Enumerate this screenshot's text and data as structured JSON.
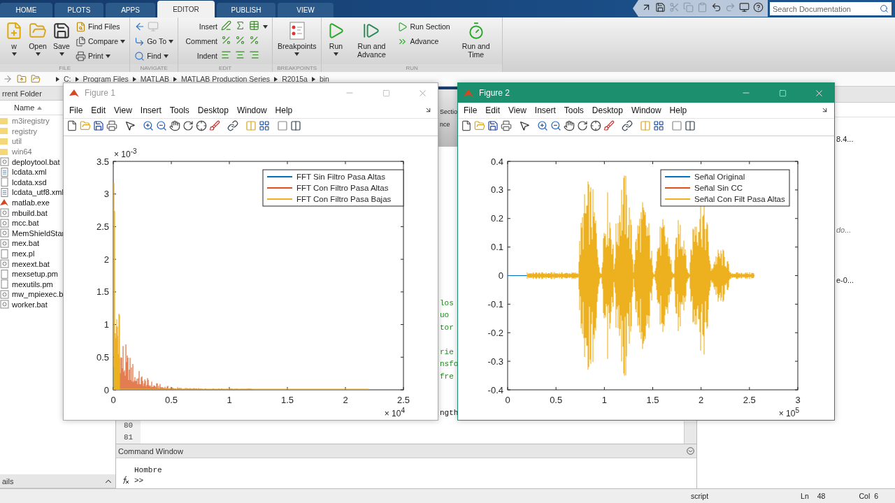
{
  "tabs": [
    {
      "label": "HOME",
      "selected": false
    },
    {
      "label": "PLOTS",
      "selected": false
    },
    {
      "label": "APPS",
      "selected": false
    },
    {
      "label": "EDITOR",
      "selected": true
    },
    {
      "label": "PUBLISH",
      "selected": false
    },
    {
      "label": "VIEW",
      "selected": false
    }
  ],
  "search": {
    "placeholder": "Search Documentation"
  },
  "toolstrip": [
    {
      "title": "FILE",
      "items": [
        {
          "label": "w",
          "kind": "large",
          "caret": true
        },
        {
          "label": "Open",
          "kind": "large",
          "caret": true
        },
        {
          "label": "Save",
          "kind": "large",
          "caret": true
        },
        {
          "label": "Find Files",
          "kind": "small",
          "caret": false
        },
        {
          "label": "Compare",
          "kind": "small",
          "caret": true
        },
        {
          "label": "Print",
          "kind": "small",
          "caret": true
        }
      ]
    },
    {
      "title": "NAVIGATE",
      "items": [
        {
          "kind": "arrows"
        },
        {
          "label": "Go To",
          "kind": "small",
          "caret": true
        },
        {
          "label": "Find",
          "kind": "small",
          "caret": true
        }
      ]
    },
    {
      "title": "EDIT",
      "items": [
        {
          "label": "Insert",
          "kind": "row",
          "caret": true
        },
        {
          "label": "Comment",
          "kind": "row",
          "caret": false
        },
        {
          "label": "Indent",
          "kind": "row",
          "caret": false
        }
      ]
    },
    {
      "title": "BREAKPOINTS",
      "items": [
        {
          "label": "Breakpoints",
          "kind": "large",
          "caret": true
        }
      ]
    },
    {
      "title": "RUN",
      "items": [
        {
          "label": "Run",
          "kind": "large",
          "caret": true
        },
        {
          "label": "Run and Advance",
          "kind": "large",
          "caret": false
        },
        {
          "label": "Run Section",
          "kind": "small",
          "caret": false
        },
        {
          "label": "Advance",
          "kind": "small",
          "caret": false
        },
        {
          "label": "Run and Time",
          "kind": "large",
          "caret": false
        }
      ]
    }
  ],
  "address": [
    "C:",
    "Program Files",
    "MATLAB",
    "MATLAB Production Series",
    "R2015a",
    "bin"
  ],
  "folder_panel": {
    "title": "rrent Folder",
    "column": "Name",
    "footer": "ails",
    "items": [
      {
        "name": "m3iregistry",
        "kind": "folder"
      },
      {
        "name": "registry",
        "kind": "folder"
      },
      {
        "name": "util",
        "kind": "folder"
      },
      {
        "name": "win64",
        "kind": "folder"
      },
      {
        "name": "deploytool.bat",
        "kind": "bat"
      },
      {
        "name": "lcdata.xml",
        "kind": "xml"
      },
      {
        "name": "lcdata.xsd",
        "kind": "blank"
      },
      {
        "name": "lcdata_utf8.xml",
        "kind": "xml"
      },
      {
        "name": "matlab.exe",
        "kind": "matlab"
      },
      {
        "name": "mbuild.bat",
        "kind": "bat"
      },
      {
        "name": "mcc.bat",
        "kind": "bat"
      },
      {
        "name": "MemShieldStar",
        "kind": "bat"
      },
      {
        "name": "mex.bat",
        "kind": "bat"
      },
      {
        "name": "mex.pl",
        "kind": "blank"
      },
      {
        "name": "mexext.bat",
        "kind": "bat"
      },
      {
        "name": "mexsetup.pm",
        "kind": "blank"
      },
      {
        "name": "mexutils.pm",
        "kind": "blank"
      },
      {
        "name": "mw_mpiexec.b",
        "kind": "bat"
      },
      {
        "name": "worker.bat",
        "kind": "bat"
      }
    ]
  },
  "editor": {
    "toolstrip": [
      "Sectio",
      "nce"
    ],
    "code": [
      {
        "text": "los",
        "kind": "comment"
      },
      {
        "text": "uo",
        "kind": "comment"
      },
      {
        "text": "tor",
        "kind": "comment"
      },
      {
        "text": "rie",
        "kind": "comment"
      },
      {
        "text": "nsfo",
        "kind": "comment"
      },
      {
        "text": "fre",
        "kind": "comment"
      },
      {
        "text": "ngth",
        "kind": "code"
      }
    ],
    "line_numbers": [
      "80",
      "81"
    ]
  },
  "command_window": {
    "title": "Command Window",
    "lines": [
      "Hombre"
    ],
    "prompt": ">>"
  },
  "workspace": [
    {
      "text": "8.4...",
      "kind": "value"
    },
    {
      "text": "do...",
      "kind": "note"
    },
    {
      "text": "e-0...",
      "kind": "value"
    }
  ],
  "status_bar": {
    "type": "script",
    "ln_label": "Ln",
    "ln": "48",
    "col_label": "Col",
    "col": "6"
  },
  "figures": [
    {
      "title": "Figure 1",
      "active": false,
      "kind": "spectrum",
      "menu": [
        "File",
        "Edit",
        "View",
        "Insert",
        "Tools",
        "Desktop",
        "Window",
        "Help"
      ],
      "yticks": [
        "3.5",
        "3",
        "2.5",
        "2",
        "1.5",
        "1",
        "0.5",
        "0"
      ],
      "xticks": [
        "0",
        "0.5",
        "1",
        "1.5",
        "2",
        "2.5"
      ],
      "y_multiplier": "× 10$^{-3}$",
      "x_multiplier": "× 10$^{4}$",
      "legend": [
        {
          "label": "FFT Sin Filtro Pasa Altas",
          "color": "#0072bd"
        },
        {
          "label": "FFT Con Filtro Pasa Altas",
          "color": "#d95319"
        },
        {
          "label": "FFT Con Filtro Pasa Bajas",
          "color": "#edb120"
        }
      ]
    },
    {
      "title": "Figure 2",
      "active": true,
      "kind": "waveform",
      "menu": [
        "File",
        "Edit",
        "View",
        "Insert",
        "Tools",
        "Desktop",
        "Window",
        "Help"
      ],
      "yticks": [
        "0.4",
        "0.3",
        "0.2",
        "0.1",
        "0",
        "-0.1",
        "-0.2",
        "-0.3",
        "-0.4"
      ],
      "xticks": [
        "0",
        "0.5",
        "1",
        "1.5",
        "2",
        "2.5",
        "3"
      ],
      "x_multiplier": "× 10$^{5}$",
      "legend": [
        {
          "label": "Señal Original",
          "color": "#0072bd"
        },
        {
          "label": "Señal Sin CC",
          "color": "#d95319"
        },
        {
          "label": "Señal Con Filt Pasa Altas",
          "color": "#edb120"
        }
      ]
    }
  ]
}
